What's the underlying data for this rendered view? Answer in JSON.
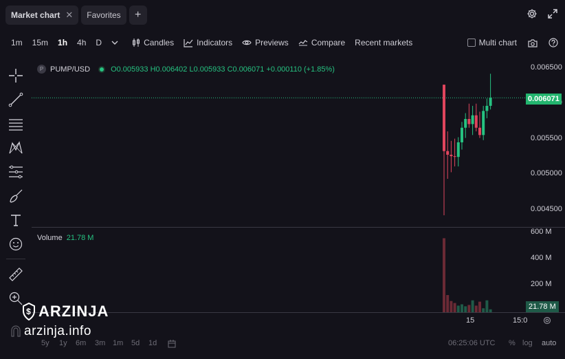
{
  "tabs": [
    {
      "label": "Market chart",
      "active": true
    },
    {
      "label": "Favorites",
      "active": false
    }
  ],
  "toolbar": {
    "timeframes": [
      "1m",
      "15m",
      "1h",
      "4h",
      "D"
    ],
    "active_timeframe": "1h",
    "candles_label": "Candles",
    "indicators_label": "Indicators",
    "previews_label": "Previews",
    "compare_label": "Compare",
    "recent_markets_label": "Recent markets",
    "multi_chart_label": "Multi chart"
  },
  "symbol": {
    "icon_letter": "P",
    "name": "PUMP/USD",
    "ohlc": {
      "open_key": "O",
      "open": "0.005933",
      "high_key": "H",
      "high": "0.006402",
      "low_key": "L",
      "low": "0.005933",
      "close_key": "C",
      "close": "0.006071",
      "change": "+0.000110 (+1.85%)"
    }
  },
  "price_axis": {
    "labels": [
      "0.006500",
      "0.006000",
      "0.005500",
      "0.005000",
      "0.004500"
    ],
    "last_price": "0.006071"
  },
  "volume": {
    "label": "Volume",
    "value": "21.78 M",
    "axis_labels": [
      "600 M",
      "400 M",
      "200 M"
    ],
    "last": "21.78 M"
  },
  "time_axis": {
    "labels": [
      "15",
      "15:0"
    ]
  },
  "bottom_bar": {
    "ranges": [
      "5y",
      "1y",
      "6m",
      "3m",
      "1m",
      "5d",
      "1d"
    ],
    "clock": "06:25:06 UTC",
    "percent": "%",
    "log": "log",
    "auto": "auto"
  },
  "watermark": {
    "brand": "ARZINJA",
    "url": "arzinja.info"
  },
  "colors": {
    "up": "#26c281",
    "down": "#e0455d",
    "background": "#13121a"
  },
  "chart_data": {
    "type": "candlestick",
    "price_range": [
      0.0043,
      0.0066
    ],
    "volume_range": [
      0,
      640
    ],
    "candles": [
      {
        "open": 0.00625,
        "high": 0.00625,
        "low": 0.00446,
        "close": 0.00534,
        "volume": 560
      },
      {
        "open": 0.00534,
        "high": 0.00561,
        "low": 0.00496,
        "close": 0.00529,
        "volume": 130
      },
      {
        "open": 0.00529,
        "high": 0.00548,
        "low": 0.00505,
        "close": 0.00527,
        "volume": 85
      },
      {
        "open": 0.00527,
        "high": 0.00551,
        "low": 0.00513,
        "close": 0.00526,
        "volume": 70
      },
      {
        "open": 0.00526,
        "high": 0.00553,
        "low": 0.00513,
        "close": 0.00546,
        "volume": 50
      },
      {
        "open": 0.00546,
        "high": 0.00574,
        "low": 0.00536,
        "close": 0.00566,
        "volume": 60
      },
      {
        "open": 0.00566,
        "high": 0.00586,
        "low": 0.00552,
        "close": 0.00578,
        "volume": 45
      },
      {
        "open": 0.00578,
        "high": 0.00599,
        "low": 0.00566,
        "close": 0.00571,
        "volume": 55
      },
      {
        "open": 0.00571,
        "high": 0.00596,
        "low": 0.00556,
        "close": 0.00583,
        "volume": 90
      },
      {
        "open": 0.00583,
        "high": 0.00599,
        "low": 0.00561,
        "close": 0.00566,
        "volume": 50
      },
      {
        "open": 0.00566,
        "high": 0.00588,
        "low": 0.00552,
        "close": 0.00556,
        "volume": 80
      },
      {
        "open": 0.00556,
        "high": 0.00596,
        "low": 0.00549,
        "close": 0.00589,
        "volume": 30
      },
      {
        "open": 0.00589,
        "high": 0.00606,
        "low": 0.00579,
        "close": 0.00596,
        "volume": 90
      },
      {
        "open": 0.00596,
        "high": 0.0064,
        "low": 0.00591,
        "close": 0.00607,
        "volume": 22
      }
    ]
  }
}
